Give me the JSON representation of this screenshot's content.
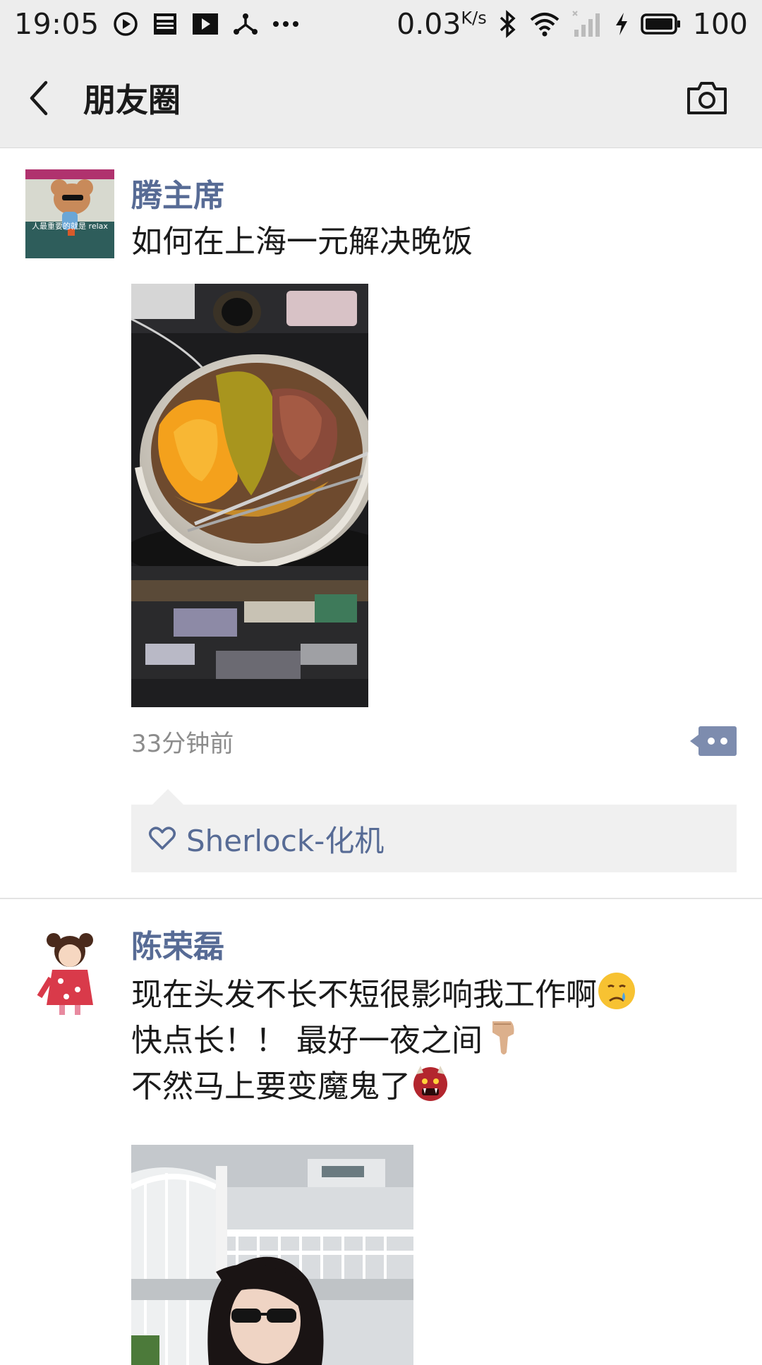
{
  "status_bar": {
    "time": "19:05",
    "speed": "0.03",
    "speed_unit": "K/s",
    "battery": "100",
    "icons": [
      "play-circle-icon",
      "news-icon",
      "video-play-icon",
      "share-node-icon",
      "more-dots-icon",
      "bluetooth-icon",
      "wifi-icon",
      "signal-icon",
      "charging-icon",
      "battery-icon"
    ]
  },
  "header": {
    "title": "朋友圈",
    "back_icon": "chevron-left-icon",
    "camera_icon": "camera-icon"
  },
  "colors": {
    "link_blue": "#576b95",
    "header_bg": "#ededed",
    "likes_bg": "#f0f0f0"
  },
  "posts": [
    {
      "username": "腾主席",
      "avatar_caption": "人最重要的就是 relax",
      "text_lines": [
        "如何在上海一元解决晚饭"
      ],
      "image": "photo-sweet-potato-bowl",
      "timestamp": "33分钟前",
      "likes": [
        "Sherlock-化机"
      ]
    },
    {
      "username": "陈荣磊",
      "text_lines": [
        "现在头发不长不短很影响我工作啊",
        "快点长！！ 最好一夜之间",
        "不然马上要变魔鬼了"
      ],
      "line_emojis": [
        "crying-face-emoji",
        "pointing-down-emoji",
        "ogre-emoji"
      ],
      "image": "photo-girl-sunglasses"
    }
  ]
}
